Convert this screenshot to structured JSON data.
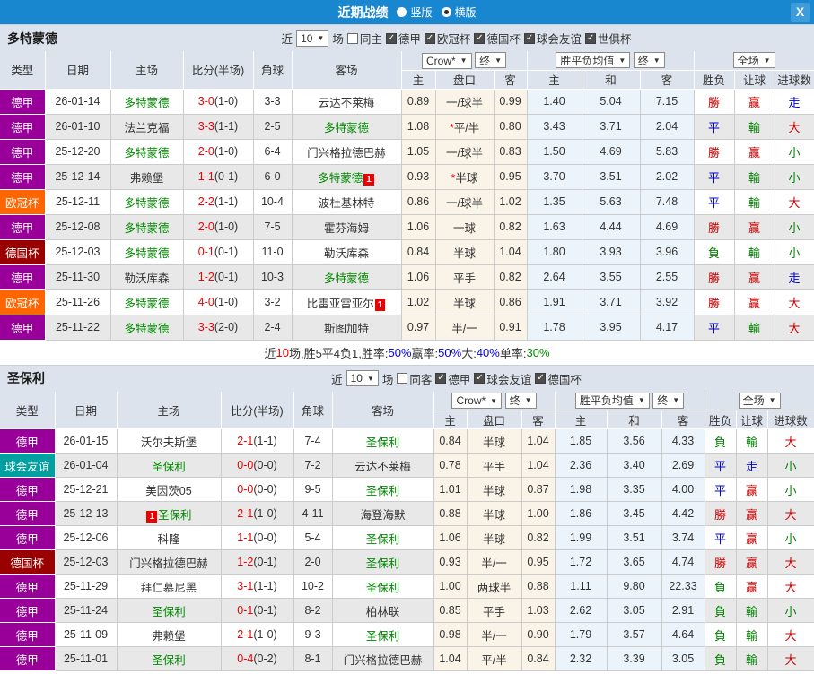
{
  "titlebar": {
    "title": "近期战绩",
    "radios": [
      {
        "label": "竖版",
        "selected": false
      },
      {
        "label": "横版",
        "selected": true
      }
    ],
    "close_label": "X"
  },
  "table": {
    "columns": [
      "类型",
      "日期",
      "主场",
      "比分(半场)",
      "角球",
      "客场"
    ],
    "sub_columns": [
      "主",
      "盘口",
      "客",
      "主",
      "和",
      "客",
      "胜负",
      "让球",
      "进球数"
    ],
    "selects": {
      "odds_company": "Crow*",
      "final1": "终",
      "avg": "胜平负均值",
      "final2": "终",
      "scope": "全场"
    },
    "dropdown_arrow": "▼"
  },
  "comp_colors": {
    "德甲": "#990099",
    "欧冠杯": "#ff6600",
    "德国杯": "#990000",
    "球会友谊": "#00a0a0"
  },
  "result_colors": {
    "勝": "#cc0000",
    "赢": "#cc0000",
    "大": "#cc0000",
    "平": "#0000cc",
    "走": "#0000cc",
    "負": "#008000",
    "輸": "#008000",
    "小": "#008000"
  },
  "accent": {
    "titlebar_bg": "#1987d0",
    "header_bg": "#dce3ed",
    "team_green": "#008a00",
    "score_red": "#ee0000",
    "handicap_bg": "#faf4e8",
    "euro_bg": "#eaf4fa"
  },
  "sections": [
    {
      "team": "多特蒙德",
      "filters": {
        "near": "近",
        "count": "10",
        "games": "场",
        "checkboxes": [
          {
            "label": "同主",
            "checked": false
          },
          {
            "label": "德甲",
            "checked": true
          },
          {
            "label": "欧冠杯",
            "checked": true
          },
          {
            "label": "德国杯",
            "checked": true
          },
          {
            "label": "球会友谊",
            "checked": true
          },
          {
            "label": "世俱杯",
            "checked": true
          }
        ]
      },
      "rows": [
        {
          "comp": "德甲",
          "date": "26-01-14",
          "home": {
            "n": "多特蒙德",
            "g": true
          },
          "score": "3-0",
          "half": "(1-0)",
          "corner": "3-3",
          "away": {
            "n": "云达不莱梅"
          },
          "ah": [
            "0.89",
            "一/球半",
            "0.99",
            false
          ],
          "eu": [
            "1.40",
            "5.04",
            "7.15"
          ],
          "res": [
            "勝",
            "赢",
            "走"
          ]
        },
        {
          "comp": "德甲",
          "date": "26-01-10",
          "home": {
            "n": "法兰克福"
          },
          "score": "3-3",
          "half": "(1-1)",
          "corner": "2-5",
          "away": {
            "n": "多特蒙德",
            "g": true
          },
          "ah": [
            "1.08",
            "平/半",
            "0.80",
            true
          ],
          "eu": [
            "3.43",
            "3.71",
            "2.04"
          ],
          "res": [
            "平",
            "輸",
            "大"
          ]
        },
        {
          "comp": "德甲",
          "date": "25-12-20",
          "home": {
            "n": "多特蒙德",
            "g": true
          },
          "score": "2-0",
          "half": "(1-0)",
          "corner": "6-4",
          "away": {
            "n": "门兴格拉德巴赫"
          },
          "ah": [
            "1.05",
            "一/球半",
            "0.83",
            false
          ],
          "eu": [
            "1.50",
            "4.69",
            "5.83"
          ],
          "res": [
            "勝",
            "赢",
            "小"
          ]
        },
        {
          "comp": "德甲",
          "date": "25-12-14",
          "home": {
            "n": "弗赖堡"
          },
          "score": "1-1",
          "half": "(0-1)",
          "corner": "6-0",
          "away": {
            "n": "多特蒙德",
            "g": true,
            "b": "1",
            "bp": "after"
          },
          "ah": [
            "0.93",
            "半球",
            "0.95",
            true
          ],
          "eu": [
            "3.70",
            "3.51",
            "2.02"
          ],
          "res": [
            "平",
            "輸",
            "小"
          ]
        },
        {
          "comp": "欧冠杯",
          "date": "25-12-11",
          "home": {
            "n": "多特蒙德",
            "g": true
          },
          "score": "2-2",
          "half": "(1-1)",
          "corner": "10-4",
          "away": {
            "n": "波杜基林特"
          },
          "ah": [
            "0.86",
            "一/球半",
            "1.02",
            false
          ],
          "eu": [
            "1.35",
            "5.63",
            "7.48"
          ],
          "res": [
            "平",
            "輸",
            "大"
          ]
        },
        {
          "comp": "德甲",
          "date": "25-12-08",
          "home": {
            "n": "多特蒙德",
            "g": true
          },
          "score": "2-0",
          "half": "(1-0)",
          "corner": "7-5",
          "away": {
            "n": "霍芬海姆"
          },
          "ah": [
            "1.06",
            "一球",
            "0.82",
            false
          ],
          "eu": [
            "1.63",
            "4.44",
            "4.69"
          ],
          "res": [
            "勝",
            "赢",
            "小"
          ]
        },
        {
          "comp": "德国杯",
          "date": "25-12-03",
          "home": {
            "n": "多特蒙德",
            "g": true
          },
          "score": "0-1",
          "half": "(0-1)",
          "corner": "11-0",
          "away": {
            "n": "勒沃库森"
          },
          "ah": [
            "0.84",
            "半球",
            "1.04",
            false
          ],
          "eu": [
            "1.80",
            "3.93",
            "3.96"
          ],
          "res": [
            "負",
            "輸",
            "小"
          ]
        },
        {
          "comp": "德甲",
          "date": "25-11-30",
          "home": {
            "n": "勒沃库森"
          },
          "score": "1-2",
          "half": "(0-1)",
          "corner": "10-3",
          "away": {
            "n": "多特蒙德",
            "g": true
          },
          "ah": [
            "1.06",
            "平手",
            "0.82",
            false
          ],
          "eu": [
            "2.64",
            "3.55",
            "2.55"
          ],
          "res": [
            "勝",
            "赢",
            "走"
          ]
        },
        {
          "comp": "欧冠杯",
          "date": "25-11-26",
          "home": {
            "n": "多特蒙德",
            "g": true
          },
          "score": "4-0",
          "half": "(1-0)",
          "corner": "3-2",
          "away": {
            "n": "比雷亚雷亚尔",
            "b": "1",
            "bp": "after"
          },
          "ah": [
            "1.02",
            "半球",
            "0.86",
            false
          ],
          "eu": [
            "1.91",
            "3.71",
            "3.92"
          ],
          "res": [
            "勝",
            "赢",
            "大"
          ]
        },
        {
          "comp": "德甲",
          "date": "25-11-22",
          "home": {
            "n": "多特蒙德",
            "g": true
          },
          "score": "3-3",
          "half": "(2-0)",
          "corner": "2-4",
          "away": {
            "n": "斯图加特"
          },
          "ah": [
            "0.97",
            "半/一",
            "0.91",
            false
          ],
          "eu": [
            "1.78",
            "3.95",
            "4.17"
          ],
          "res": [
            "平",
            "輸",
            "大"
          ]
        }
      ],
      "summary": [
        {
          "text": "近",
          "color": "#333333"
        },
        {
          "text": "10",
          "color": "#ee0000"
        },
        {
          "text": "场,胜5平4负1, ",
          "color": "#333333"
        },
        {
          "text": "胜率:",
          "color": "#333333"
        },
        {
          "text": "50%",
          "color": "#0000dd"
        },
        {
          "text": " 赢率:",
          "color": "#333333"
        },
        {
          "text": "50%",
          "color": "#0000dd"
        },
        {
          "text": " 大:",
          "color": "#333333"
        },
        {
          "text": "40%",
          "color": "#0000dd"
        },
        {
          "text": " 单率:",
          "color": "#333333"
        },
        {
          "text": "30%",
          "color": "#008800"
        }
      ]
    },
    {
      "team": "圣保利",
      "filters": {
        "near": "近",
        "count": "10",
        "games": "场",
        "checkboxes": [
          {
            "label": "同客",
            "checked": false
          },
          {
            "label": "德甲",
            "checked": true
          },
          {
            "label": "球会友谊",
            "checked": true
          },
          {
            "label": "德国杯",
            "checked": true
          }
        ]
      },
      "rows": [
        {
          "comp": "德甲",
          "date": "26-01-15",
          "home": {
            "n": "沃尔夫斯堡"
          },
          "score": "2-1",
          "half": "(1-1)",
          "corner": "7-4",
          "away": {
            "n": "圣保利",
            "g": true
          },
          "ah": [
            "0.84",
            "半球",
            "1.04",
            false
          ],
          "eu": [
            "1.85",
            "3.56",
            "4.33"
          ],
          "res": [
            "負",
            "輸",
            "大"
          ]
        },
        {
          "comp": "球会友谊",
          "date": "26-01-04",
          "home": {
            "n": "圣保利",
            "g": true
          },
          "score": "0-0",
          "half": "(0-0)",
          "corner": "7-2",
          "away": {
            "n": "云达不莱梅"
          },
          "ah": [
            "0.78",
            "平手",
            "1.04",
            false
          ],
          "eu": [
            "2.36",
            "3.40",
            "2.69"
          ],
          "res": [
            "平",
            "走",
            "小"
          ]
        },
        {
          "comp": "德甲",
          "date": "25-12-21",
          "home": {
            "n": "美因茨05"
          },
          "score": "0-0",
          "half": "(0-0)",
          "corner": "9-5",
          "away": {
            "n": "圣保利",
            "g": true
          },
          "ah": [
            "1.01",
            "半球",
            "0.87",
            false
          ],
          "eu": [
            "1.98",
            "3.35",
            "4.00"
          ],
          "res": [
            "平",
            "赢",
            "小"
          ]
        },
        {
          "comp": "德甲",
          "date": "25-12-13",
          "home": {
            "n": "圣保利",
            "g": true,
            "b": "1",
            "bp": "before"
          },
          "score": "2-1",
          "half": "(1-0)",
          "corner": "4-11",
          "away": {
            "n": "海登海默"
          },
          "ah": [
            "0.88",
            "半球",
            "1.00",
            false
          ],
          "eu": [
            "1.86",
            "3.45",
            "4.42"
          ],
          "res": [
            "勝",
            "赢",
            "大"
          ]
        },
        {
          "comp": "德甲",
          "date": "25-12-06",
          "home": {
            "n": "科隆"
          },
          "score": "1-1",
          "half": "(0-0)",
          "corner": "5-4",
          "away": {
            "n": "圣保利",
            "g": true
          },
          "ah": [
            "1.06",
            "半球",
            "0.82",
            false
          ],
          "eu": [
            "1.99",
            "3.51",
            "3.74"
          ],
          "res": [
            "平",
            "赢",
            "小"
          ]
        },
        {
          "comp": "德国杯",
          "date": "25-12-03",
          "home": {
            "n": "门兴格拉德巴赫"
          },
          "score": "1-2",
          "half": "(0-1)",
          "corner": "2-0",
          "away": {
            "n": "圣保利",
            "g": true
          },
          "ah": [
            "0.93",
            "半/一",
            "0.95",
            false
          ],
          "eu": [
            "1.72",
            "3.65",
            "4.74"
          ],
          "res": [
            "勝",
            "赢",
            "大"
          ]
        },
        {
          "comp": "德甲",
          "date": "25-11-29",
          "home": {
            "n": "拜仁慕尼黑"
          },
          "score": "3-1",
          "half": "(1-1)",
          "corner": "10-2",
          "away": {
            "n": "圣保利",
            "g": true
          },
          "ah": [
            "1.00",
            "两球半",
            "0.88",
            false
          ],
          "eu": [
            "1.11",
            "9.80",
            "22.33"
          ],
          "res": [
            "負",
            "赢",
            "大"
          ]
        },
        {
          "comp": "德甲",
          "date": "25-11-24",
          "home": {
            "n": "圣保利",
            "g": true
          },
          "score": "0-1",
          "half": "(0-1)",
          "corner": "8-2",
          "away": {
            "n": "柏林联"
          },
          "ah": [
            "0.85",
            "平手",
            "1.03",
            false
          ],
          "eu": [
            "2.62",
            "3.05",
            "2.91"
          ],
          "res": [
            "負",
            "輸",
            "小"
          ]
        },
        {
          "comp": "德甲",
          "date": "25-11-09",
          "home": {
            "n": "弗赖堡"
          },
          "score": "2-1",
          "half": "(1-0)",
          "corner": "9-3",
          "away": {
            "n": "圣保利",
            "g": true
          },
          "ah": [
            "0.98",
            "半/一",
            "0.90",
            false
          ],
          "eu": [
            "1.79",
            "3.57",
            "4.64"
          ],
          "res": [
            "負",
            "輸",
            "大"
          ]
        },
        {
          "comp": "德甲",
          "date": "25-11-01",
          "home": {
            "n": "圣保利",
            "g": true
          },
          "score": "0-4",
          "half": "(0-2)",
          "corner": "8-1",
          "away": {
            "n": "门兴格拉德巴赫"
          },
          "ah": [
            "1.04",
            "平/半",
            "0.84",
            false
          ],
          "eu": [
            "2.32",
            "3.39",
            "3.05"
          ],
          "res": [
            "負",
            "輸",
            "大"
          ]
        }
      ],
      "summary": null
    }
  ]
}
